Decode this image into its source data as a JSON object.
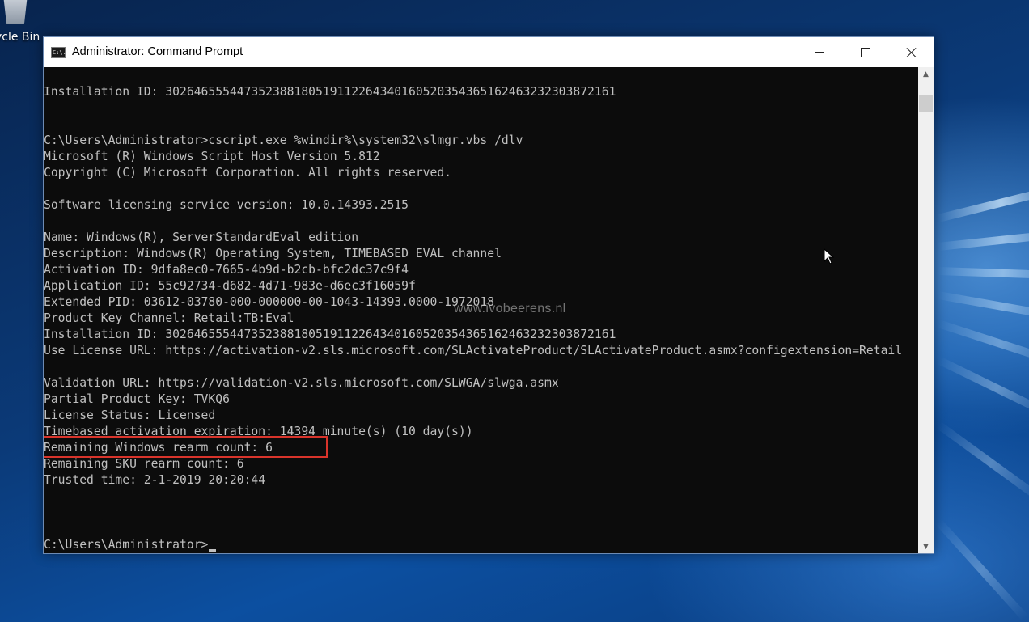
{
  "desktop": {
    "recycle_bin_label": "ycle Bin"
  },
  "window": {
    "title": "Administrator: Command Prompt",
    "icon_text": "C:\\."
  },
  "console": {
    "lines": [
      "Installation ID: 302646555447352388180519112264340160520354365162463232303872161",
      "",
      "",
      "C:\\Users\\Administrator>cscript.exe %windir%\\system32\\slmgr.vbs /dlv",
      "Microsoft (R) Windows Script Host Version 5.812",
      "Copyright (C) Microsoft Corporation. All rights reserved.",
      "",
      "Software licensing service version: 10.0.14393.2515",
      "",
      "Name: Windows(R), ServerStandardEval edition",
      "Description: Windows(R) Operating System, TIMEBASED_EVAL channel",
      "Activation ID: 9dfa8ec0-7665-4b9d-b2cb-bfc2dc37c9f4",
      "Application ID: 55c92734-d682-4d71-983e-d6ec3f16059f",
      "Extended PID: 03612-03780-000-000000-00-1043-14393.0000-1972018",
      "Product Key Channel: Retail:TB:Eval",
      "Installation ID: 302646555447352388180519112264340160520354365162463232303872161",
      "Use License URL: https://activation-v2.sls.microsoft.com/SLActivateProduct/SLActivateProduct.asmx?configextension=Retail",
      "",
      "Validation URL: https://validation-v2.sls.microsoft.com/SLWGA/slwga.asmx",
      "Partial Product Key: TVKQ6",
      "License Status: Licensed",
      "Timebased activation expiration: 14394 minute(s) (10 day(s))",
      "Remaining Windows rearm count: 6",
      "Remaining SKU rearm count: 6",
      "Trusted time: 2-1-2019 20:20:44",
      "",
      "",
      ""
    ],
    "prompt": "C:\\Users\\Administrator>",
    "watermark": "www.ivobeerens.nl"
  },
  "colors": {
    "console_bg": "#0c0c0c",
    "console_fg": "#c0c0c0",
    "highlight": "#d9342b"
  },
  "icons": {
    "minimize": "minimize-icon",
    "maximize": "maximize-icon",
    "close": "close-icon",
    "scroll_up": "chevron-up-icon",
    "scroll_down": "chevron-down-icon"
  }
}
